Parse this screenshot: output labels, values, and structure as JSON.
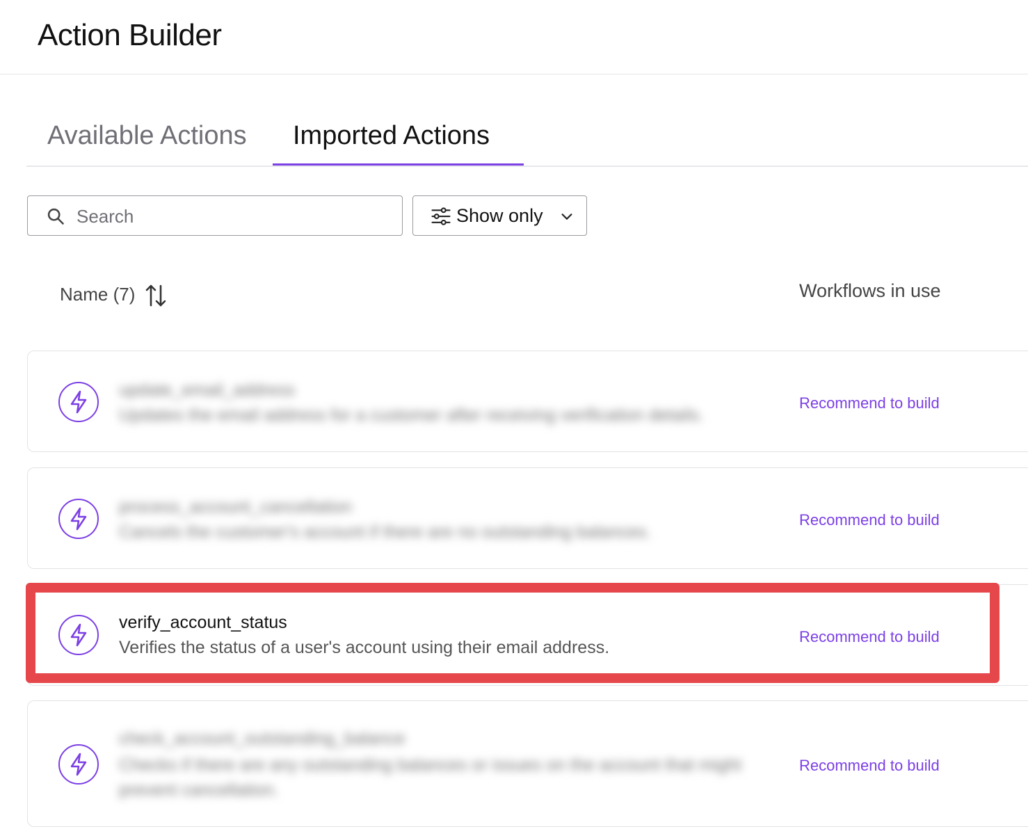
{
  "header": {
    "title": "Action Builder"
  },
  "tabs": [
    {
      "label": "Available Actions",
      "active": false
    },
    {
      "label": "Imported Actions",
      "active": true
    }
  ],
  "search": {
    "placeholder": "Search",
    "value": ""
  },
  "filter": {
    "label": "Show only"
  },
  "columns": {
    "name": "Name (7)",
    "workflows": "Workflows in use"
  },
  "rows": [
    {
      "name": "update_email_address",
      "description": "Updates the email address for a customer after receiving verification details.",
      "action": "Recommend to build",
      "blurred": true
    },
    {
      "name": "process_account_cancellation",
      "description": "Cancels the customer's account if there are no outstanding balances.",
      "action": "Recommend to build",
      "blurred": true
    },
    {
      "name": "verify_account_status",
      "description": "Verifies the status of a user's account using their email address.",
      "action": "Recommend to build",
      "blurred": false,
      "highlighted": true
    },
    {
      "name": "check_account_outstanding_balance",
      "description": "Checks if there are any outstanding balances or issues on the account that might prevent cancellation.",
      "action": "Recommend to build",
      "blurred": true
    }
  ],
  "colors": {
    "accent": "#7b3fe4",
    "highlight": "#e5474b",
    "border": "#e3e3e7"
  },
  "icons": {
    "search": "search-icon",
    "filter": "filter-sliders-icon",
    "chevron": "chevron-down-icon",
    "sort": "sort-arrows-icon",
    "action": "lightning-bolt-icon"
  }
}
